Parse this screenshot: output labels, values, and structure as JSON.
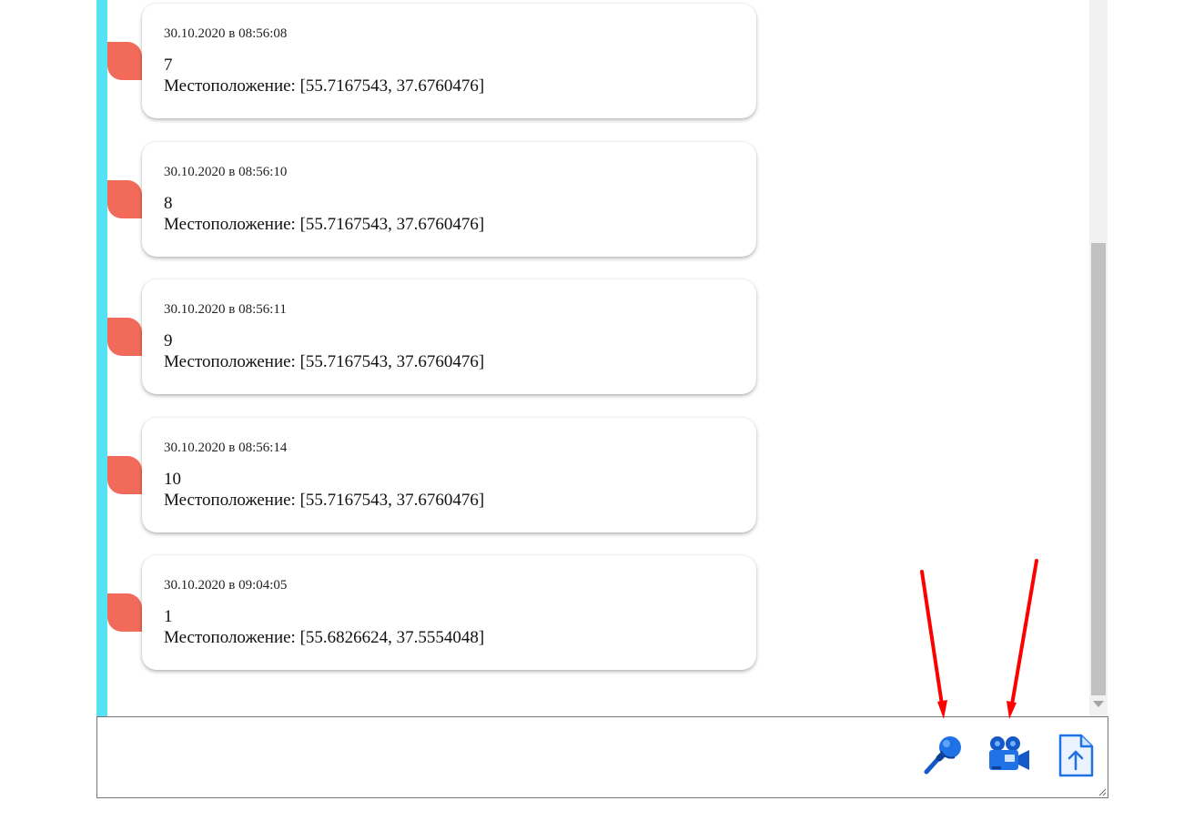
{
  "messages": [
    {
      "date": "30.10.2020 в 08:56:08",
      "number": "7",
      "location": "Местоположение: [55.7167543, 37.6760476]"
    },
    {
      "date": "30.10.2020 в 08:56:10",
      "number": "8",
      "location": "Местоположение: [55.7167543, 37.6760476]"
    },
    {
      "date": "30.10.2020 в 08:56:11",
      "number": "9",
      "location": "Местоположение: [55.7167543, 37.6760476]"
    },
    {
      "date": "30.10.2020 в 08:56:14",
      "number": "10",
      "location": "Местоположение: [55.7167543, 37.6760476]"
    },
    {
      "date": "30.10.2020 в 09:04:05",
      "number": "1",
      "location": "Местоположение: [55.6826624, 37.5554048]"
    }
  ],
  "composer": {
    "value": "",
    "placeholder": ""
  },
  "toolbar": {
    "icons": [
      "microphone-icon",
      "video-camera-icon",
      "file-upload-icon"
    ]
  },
  "colors": {
    "accent_bar": "#55e3f4",
    "bubble_tail": "#f26a5a",
    "icon_blue": "#1e72e6",
    "annotation_arrow": "#ff0000"
  }
}
